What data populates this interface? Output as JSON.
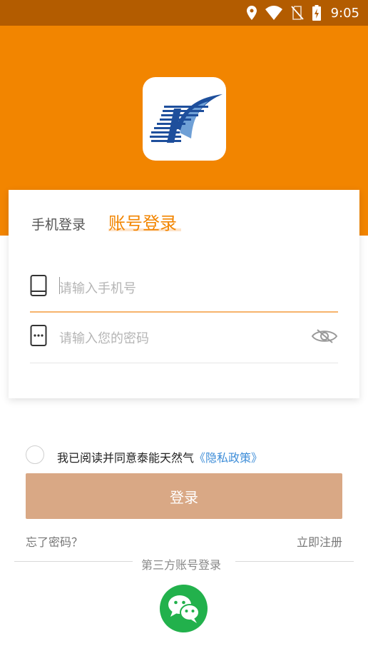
{
  "status_bar": {
    "time": "9:05"
  },
  "brand": {
    "accent": "#f28500",
    "status_bar": "#b35c00",
    "button": "#d9a885",
    "link": "#3f8ed8",
    "wechat": "#22b14c"
  },
  "tabs": {
    "phone_label": "手机登录",
    "account_label": "账号登录",
    "active": "account"
  },
  "form": {
    "phone_placeholder": "请输入手机号",
    "password_placeholder": "请输入您的密码"
  },
  "agreement": {
    "prefix": "我已阅读并同意泰能天然气",
    "policy_link": "《隐私政策》",
    "checked": false
  },
  "login_button": "登录",
  "forgot_password": "忘了密码？",
  "register": "立即注册",
  "third_party": {
    "label": "第三方账号登录",
    "providers": [
      "wechat-icon"
    ]
  }
}
